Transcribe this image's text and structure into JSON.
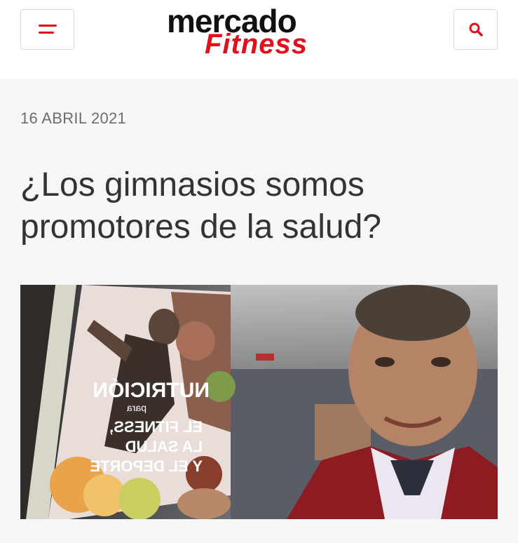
{
  "header": {
    "logo_top": "mercado",
    "logo_bottom": "Fitness",
    "menu_icon": "hamburger-menu-icon",
    "search_icon": "search-icon",
    "brand_color": "#e1111b",
    "logo_dark": "#111111"
  },
  "article": {
    "date": "16 ABRIL 2021",
    "title": "¿Los gimnasios somos promotores de la salud?",
    "image": {
      "book_title": "NUTRICIÓN",
      "book_para": "para",
      "book_line1": "EL FITNESS,",
      "book_line2": "LA SALUD",
      "book_line3": "Y EL DEPORTE"
    }
  }
}
